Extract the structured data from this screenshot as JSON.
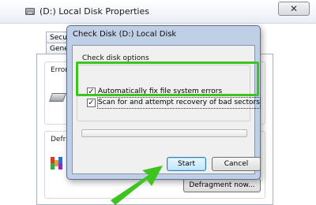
{
  "window": {
    "title": "(D:) Local Disk Properties",
    "close_glyph": "✕",
    "tabs": [
      {
        "label": "Security"
      },
      {
        "label": "General"
      }
    ],
    "error_checking_label": "Error",
    "defrag_label": "Defra",
    "defragment_button": "Defragment now..."
  },
  "dialog": {
    "title": "Check Disk (D:) Local Disk",
    "options_label": "Check disk options",
    "options": [
      {
        "label": "Automatically fix file system errors",
        "checked": true
      },
      {
        "label": "Scan for and attempt recovery of bad sectors",
        "checked": true
      }
    ],
    "checkbox_glyph": "✓",
    "progress": 0,
    "start_button": "Start",
    "cancel_button": "Cancel"
  },
  "annotation": {
    "highlight_color": "#3fc31f",
    "arrow_color": "#3fc31f"
  }
}
